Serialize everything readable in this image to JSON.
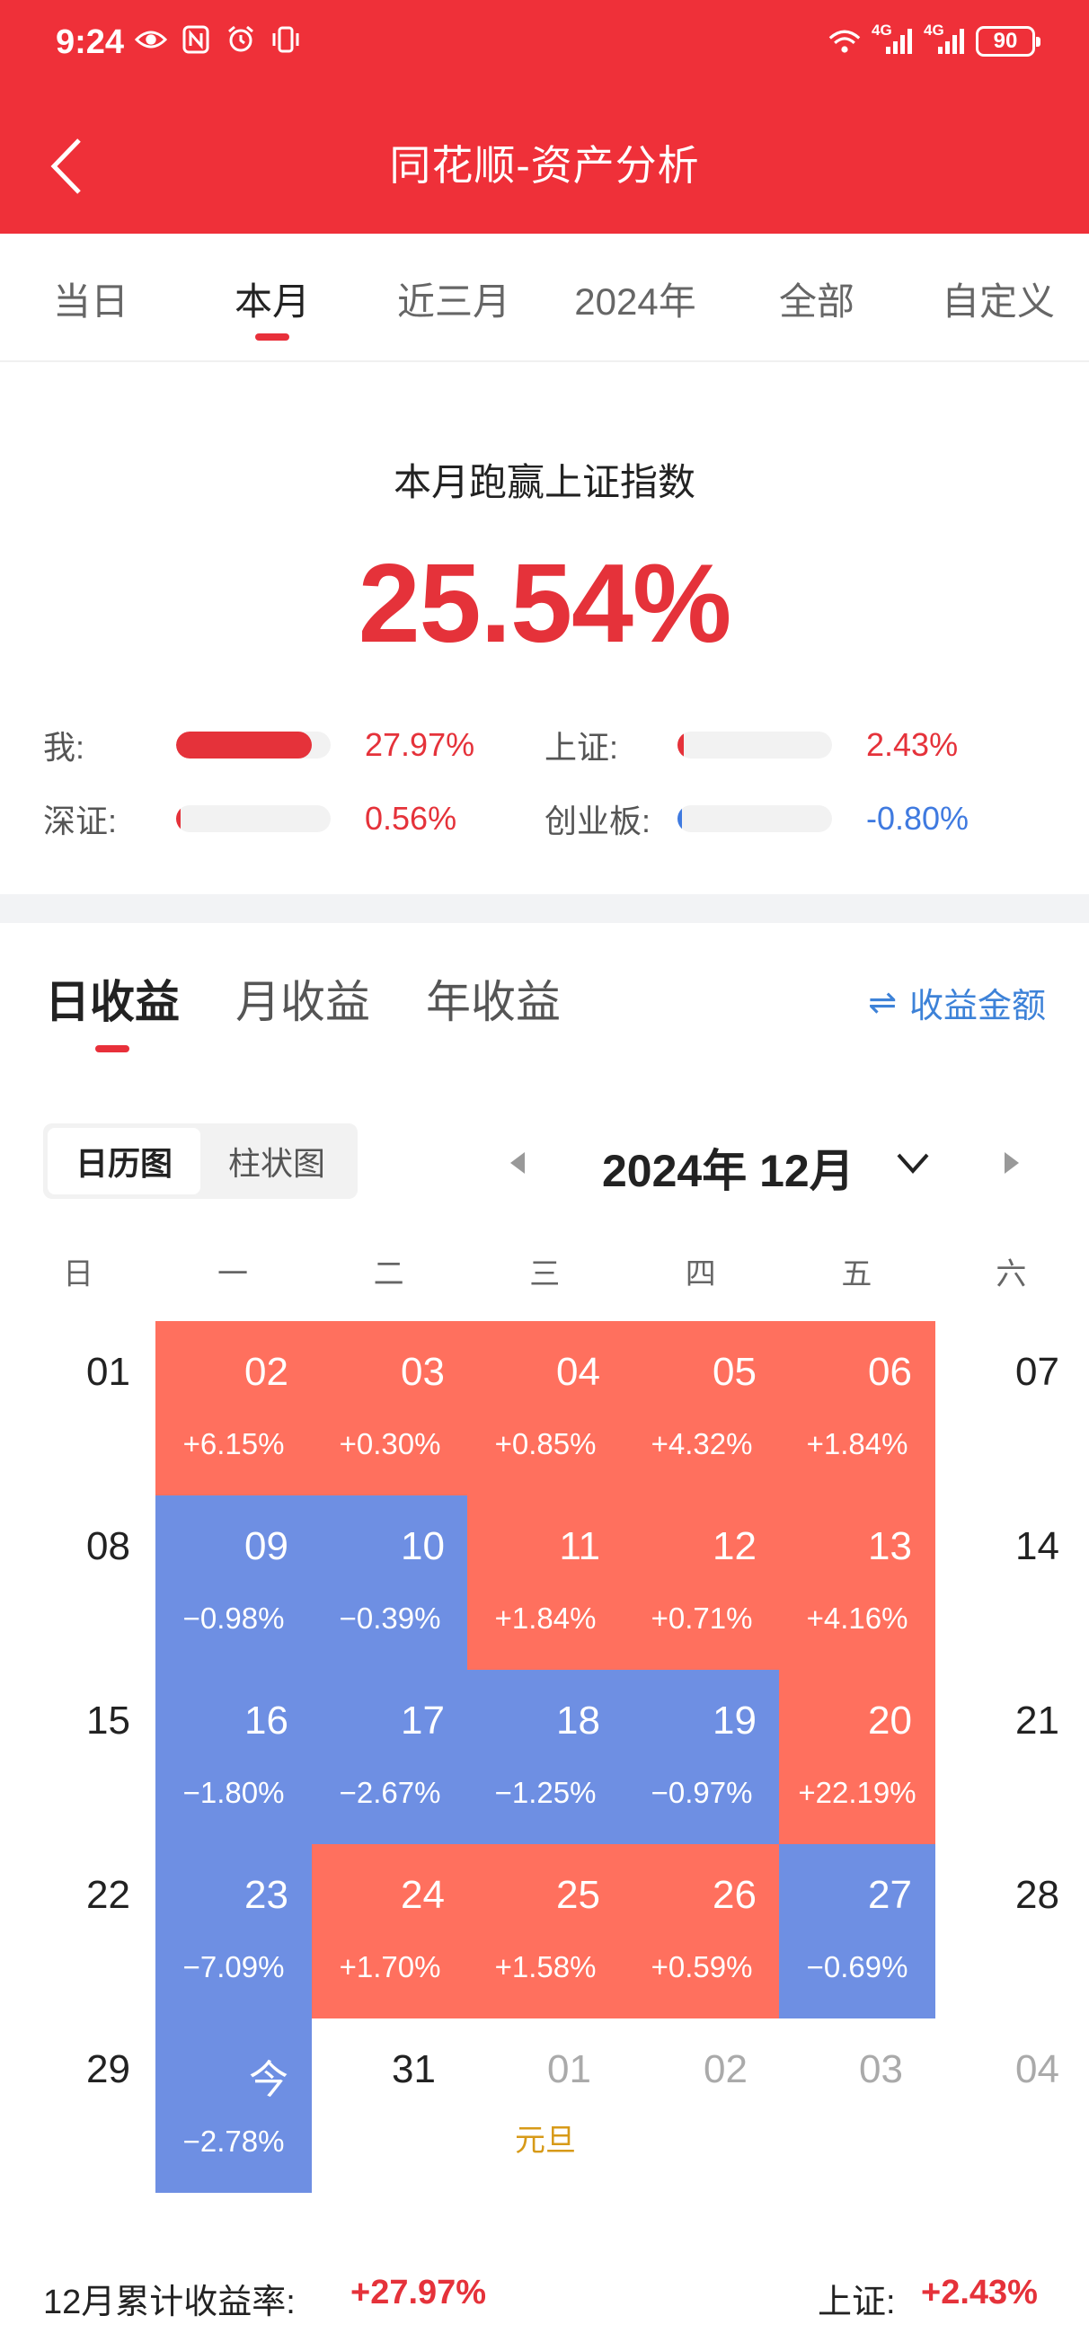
{
  "status_bar": {
    "time": "9:24",
    "battery": "90",
    "network_1": "4G",
    "network_2": "4G"
  },
  "header": {
    "title": "同花顺-资产分析"
  },
  "period_tabs": [
    {
      "label": "当日",
      "active": false
    },
    {
      "label": "本月",
      "active": true
    },
    {
      "label": "近三月",
      "active": false
    },
    {
      "label": "2024年",
      "active": false
    },
    {
      "label": "全部",
      "active": false
    },
    {
      "label": "自定义",
      "active": false
    }
  ],
  "summary": {
    "label": "本月跑赢上证指数",
    "value": "25.54%",
    "comparisons": [
      {
        "name": "我:",
        "value": "27.97%",
        "fill": 0.88,
        "color": "#e5323a"
      },
      {
        "name": "上证:",
        "value": "2.43%",
        "fill": 0.04,
        "color": "#e5323a"
      },
      {
        "name": "深证:",
        "value": "0.56%",
        "fill": 0.01,
        "color": "#e5323a"
      },
      {
        "name": "创业板:",
        "value": "-0.80%",
        "fill": 0.01,
        "color": "#3f7ae0"
      }
    ]
  },
  "returns": {
    "tabs": [
      {
        "label": "日收益",
        "active": true
      },
      {
        "label": "月收益",
        "active": false
      },
      {
        "label": "年收益",
        "active": false
      }
    ],
    "amount_toggle": "收益金额",
    "view_toggle": {
      "calendar": "日历图",
      "bar": "柱状图"
    },
    "month_label": "2024年 12月"
  },
  "calendar": {
    "weekdays": [
      "日",
      "一",
      "二",
      "三",
      "四",
      "五",
      "六"
    ],
    "weeks": [
      [
        {
          "d": "01",
          "s": "plain"
        },
        {
          "d": "02",
          "p": "+6.15%",
          "s": "up"
        },
        {
          "d": "03",
          "p": "+0.30%",
          "s": "up"
        },
        {
          "d": "04",
          "p": "+0.85%",
          "s": "up"
        },
        {
          "d": "05",
          "p": "+4.32%",
          "s": "up"
        },
        {
          "d": "06",
          "p": "+1.84%",
          "s": "up"
        },
        {
          "d": "07",
          "s": "plain"
        }
      ],
      [
        {
          "d": "08",
          "s": "plain"
        },
        {
          "d": "09",
          "p": "−0.98%",
          "s": "down"
        },
        {
          "d": "10",
          "p": "−0.39%",
          "s": "down"
        },
        {
          "d": "11",
          "p": "+1.84%",
          "s": "up"
        },
        {
          "d": "12",
          "p": "+0.71%",
          "s": "up"
        },
        {
          "d": "13",
          "p": "+4.16%",
          "s": "up"
        },
        {
          "d": "14",
          "s": "plain"
        }
      ],
      [
        {
          "d": "15",
          "s": "plain"
        },
        {
          "d": "16",
          "p": "−1.80%",
          "s": "down"
        },
        {
          "d": "17",
          "p": "−2.67%",
          "s": "down"
        },
        {
          "d": "18",
          "p": "−1.25%",
          "s": "down"
        },
        {
          "d": "19",
          "p": "−0.97%",
          "s": "down"
        },
        {
          "d": "20",
          "p": "+22.19%",
          "s": "up"
        },
        {
          "d": "21",
          "s": "plain"
        }
      ],
      [
        {
          "d": "22",
          "s": "plain"
        },
        {
          "d": "23",
          "p": "−7.09%",
          "s": "down"
        },
        {
          "d": "24",
          "p": "+1.70%",
          "s": "up"
        },
        {
          "d": "25",
          "p": "+1.58%",
          "s": "up"
        },
        {
          "d": "26",
          "p": "+0.59%",
          "s": "up"
        },
        {
          "d": "27",
          "p": "−0.69%",
          "s": "down"
        },
        {
          "d": "28",
          "s": "plain"
        }
      ],
      [
        {
          "d": "29",
          "s": "plain"
        },
        {
          "d": "今",
          "p": "−2.78%",
          "s": "down"
        },
        {
          "d": "31",
          "s": "plain"
        },
        {
          "d": "01",
          "h": "元旦",
          "s": "muted"
        },
        {
          "d": "02",
          "s": "muted"
        },
        {
          "d": "03",
          "s": "muted"
        },
        {
          "d": "04",
          "s": "muted"
        }
      ]
    ]
  },
  "footer": {
    "cumulative_label": "12月累计收益率:",
    "cumulative_value": "+27.97%",
    "index_label": "上证:",
    "index_value": "+2.43%"
  }
}
